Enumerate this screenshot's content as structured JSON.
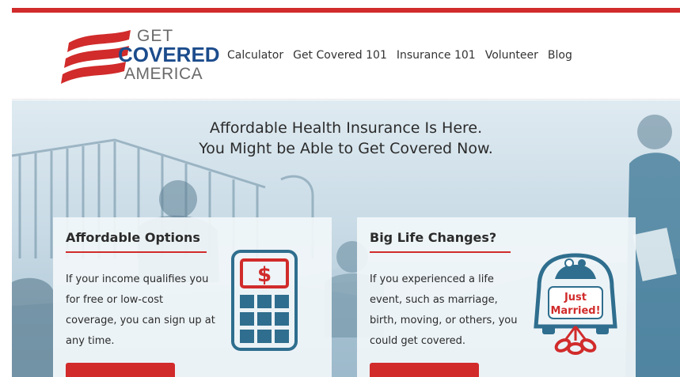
{
  "brand": {
    "logo_line1": "GET",
    "logo_line2": "COVERED",
    "logo_line3": "AMERICA",
    "accent_red": "#d12b2b",
    "brand_blue": "#1c4c8c",
    "icon_blue": "#2f6e8e"
  },
  "nav": {
    "items": [
      {
        "label": "Calculator"
      },
      {
        "label": "Get Covered 101"
      },
      {
        "label": "Insurance 101"
      },
      {
        "label": "Volunteer"
      },
      {
        "label": "Blog"
      }
    ]
  },
  "hero": {
    "headline_line1": "Affordable Health Insurance Is Here.",
    "headline_line2": "You Might be Able to Get Covered Now."
  },
  "cards": [
    {
      "title": "Affordable Options",
      "body": "If your income qualifies you for free or low-cost coverage, you can sign up at any time.",
      "icon": "calculator-icon",
      "icon_text": "$"
    },
    {
      "title": "Big Life Changes?",
      "body": "If you experienced a life event, such as marriage, birth, moving, or others, you could get covered.",
      "icon": "just-married-car-icon",
      "icon_text_line1": "Just",
      "icon_text_line2": "Married!"
    }
  ]
}
